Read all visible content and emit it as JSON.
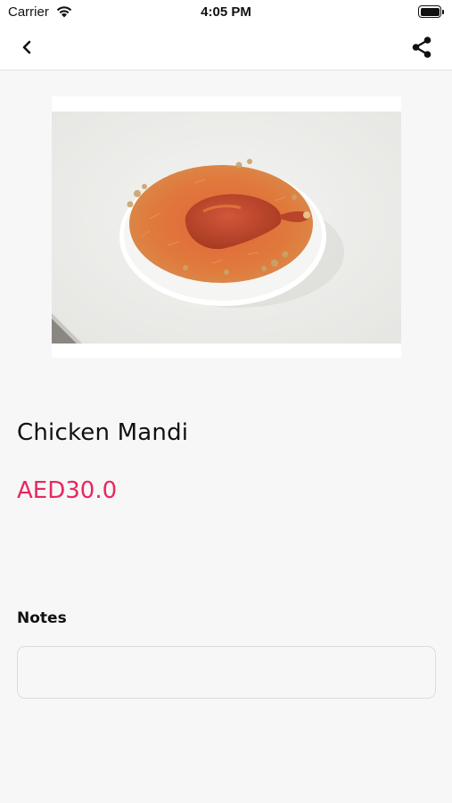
{
  "status_bar": {
    "carrier": "Carrier",
    "time": "4:05 PM"
  },
  "nav": {
    "back_icon": "chevron-left-icon",
    "share_icon": "share-icon"
  },
  "item": {
    "name": "Chicken Mandi",
    "price": "AED30.0",
    "price_color": "#e8285f"
  },
  "notes": {
    "label": "Notes",
    "value": "",
    "placeholder": ""
  }
}
